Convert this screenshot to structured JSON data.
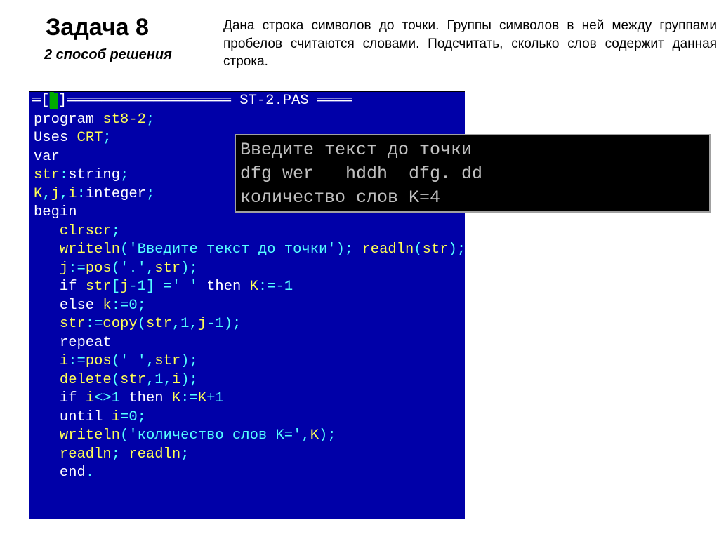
{
  "header": {
    "title": "Задача 8",
    "subtitle": "2 способ решения",
    "description": "Дана строка символов до точки. Группы символов в ней между группами пробелов считаются словами. Подсчитать, сколько слов содержит данная строка."
  },
  "editor": {
    "title_left": "═[",
    "title_cursor": "▌",
    "title_mid": "]═══════════════════ ",
    "filename": "ST-2.PAS",
    "title_right": " ════",
    "lines": [
      {
        "t": "kw",
        "s": "program "
      },
      {
        "t": "id",
        "s": "st8-2"
      },
      {
        "t": "op",
        "s": ";"
      },
      {
        "t": "br"
      },
      {
        "t": "kw",
        "s": "Uses "
      },
      {
        "t": "id",
        "s": "CRT"
      },
      {
        "t": "op",
        "s": ";"
      },
      {
        "t": "br"
      },
      {
        "t": "kw",
        "s": "var"
      },
      {
        "t": "br"
      },
      {
        "t": "id",
        "s": "str"
      },
      {
        "t": "op",
        "s": ":"
      },
      {
        "t": "kw",
        "s": "string"
      },
      {
        "t": "op",
        "s": ";"
      },
      {
        "t": "br"
      },
      {
        "t": "id",
        "s": "K"
      },
      {
        "t": "op",
        "s": ","
      },
      {
        "t": "id",
        "s": "j"
      },
      {
        "t": "op",
        "s": ","
      },
      {
        "t": "id",
        "s": "i"
      },
      {
        "t": "op",
        "s": ":"
      },
      {
        "t": "kw",
        "s": "integer"
      },
      {
        "t": "op",
        "s": ";"
      },
      {
        "t": "br"
      },
      {
        "t": "kw",
        "s": "begin"
      },
      {
        "t": "br"
      },
      {
        "t": "id",
        "s": "   clrscr"
      },
      {
        "t": "op",
        "s": ";"
      },
      {
        "t": "br"
      },
      {
        "t": "id",
        "s": "   writeln"
      },
      {
        "t": "op",
        "s": "("
      },
      {
        "t": "str",
        "s": "'Введите текст до точки'"
      },
      {
        "t": "op",
        "s": "); "
      },
      {
        "t": "id",
        "s": "readln"
      },
      {
        "t": "op",
        "s": "("
      },
      {
        "t": "id",
        "s": "str"
      },
      {
        "t": "op",
        "s": ");"
      },
      {
        "t": "br"
      },
      {
        "t": "id",
        "s": "   j"
      },
      {
        "t": "op",
        "s": ":="
      },
      {
        "t": "id",
        "s": "pos"
      },
      {
        "t": "op",
        "s": "("
      },
      {
        "t": "str",
        "s": "'.'"
      },
      {
        "t": "op",
        "s": ","
      },
      {
        "t": "id",
        "s": "str"
      },
      {
        "t": "op",
        "s": ");"
      },
      {
        "t": "br"
      },
      {
        "t": "kw",
        "s": "   if "
      },
      {
        "t": "id",
        "s": "str"
      },
      {
        "t": "op",
        "s": "["
      },
      {
        "t": "id",
        "s": "j"
      },
      {
        "t": "op",
        "s": "-"
      },
      {
        "t": "ty",
        "s": "1"
      },
      {
        "t": "op",
        "s": "] ="
      },
      {
        "t": "str",
        "s": "' '"
      },
      {
        "t": "kw",
        "s": " then "
      },
      {
        "t": "id",
        "s": "K"
      },
      {
        "t": "op",
        "s": ":=-"
      },
      {
        "t": "ty",
        "s": "1"
      },
      {
        "t": "br"
      },
      {
        "t": "kw",
        "s": "   else "
      },
      {
        "t": "id",
        "s": "k"
      },
      {
        "t": "op",
        "s": ":="
      },
      {
        "t": "ty",
        "s": "0"
      },
      {
        "t": "op",
        "s": ";"
      },
      {
        "t": "br"
      },
      {
        "t": "id",
        "s": "   str"
      },
      {
        "t": "op",
        "s": ":="
      },
      {
        "t": "id",
        "s": "copy"
      },
      {
        "t": "op",
        "s": "("
      },
      {
        "t": "id",
        "s": "str"
      },
      {
        "t": "op",
        "s": ","
      },
      {
        "t": "ty",
        "s": "1"
      },
      {
        "t": "op",
        "s": ","
      },
      {
        "t": "id",
        "s": "j"
      },
      {
        "t": "op",
        "s": "-"
      },
      {
        "t": "ty",
        "s": "1"
      },
      {
        "t": "op",
        "s": ");"
      },
      {
        "t": "br"
      },
      {
        "t": "kw",
        "s": "   repeat"
      },
      {
        "t": "br"
      },
      {
        "t": "id",
        "s": "   i"
      },
      {
        "t": "op",
        "s": ":="
      },
      {
        "t": "id",
        "s": "pos"
      },
      {
        "t": "op",
        "s": "("
      },
      {
        "t": "str",
        "s": "' '"
      },
      {
        "t": "op",
        "s": ","
      },
      {
        "t": "id",
        "s": "str"
      },
      {
        "t": "op",
        "s": ");"
      },
      {
        "t": "br"
      },
      {
        "t": "id",
        "s": "   delete"
      },
      {
        "t": "op",
        "s": "("
      },
      {
        "t": "id",
        "s": "str"
      },
      {
        "t": "op",
        "s": ","
      },
      {
        "t": "ty",
        "s": "1"
      },
      {
        "t": "op",
        "s": ","
      },
      {
        "t": "id",
        "s": "i"
      },
      {
        "t": "op",
        "s": ");"
      },
      {
        "t": "br"
      },
      {
        "t": "kw",
        "s": "   if "
      },
      {
        "t": "id",
        "s": "i"
      },
      {
        "t": "op",
        "s": "<>"
      },
      {
        "t": "ty",
        "s": "1"
      },
      {
        "t": "kw",
        "s": " then "
      },
      {
        "t": "id",
        "s": "K"
      },
      {
        "t": "op",
        "s": ":="
      },
      {
        "t": "id",
        "s": "K"
      },
      {
        "t": "op",
        "s": "+"
      },
      {
        "t": "ty",
        "s": "1"
      },
      {
        "t": "br"
      },
      {
        "t": "kw",
        "s": "   until "
      },
      {
        "t": "id",
        "s": "i"
      },
      {
        "t": "op",
        "s": "="
      },
      {
        "t": "ty",
        "s": "0"
      },
      {
        "t": "op",
        "s": ";"
      },
      {
        "t": "br"
      },
      {
        "t": "id",
        "s": "   writeln"
      },
      {
        "t": "op",
        "s": "("
      },
      {
        "t": "str",
        "s": "'количество слов K='"
      },
      {
        "t": "op",
        "s": ","
      },
      {
        "t": "id",
        "s": "K"
      },
      {
        "t": "op",
        "s": ");"
      },
      {
        "t": "br"
      },
      {
        "t": "id",
        "s": "   readln"
      },
      {
        "t": "op",
        "s": "; "
      },
      {
        "t": "id",
        "s": "readln"
      },
      {
        "t": "op",
        "s": ";"
      },
      {
        "t": "br"
      },
      {
        "t": "kw",
        "s": "   end"
      },
      {
        "t": "op",
        "s": "."
      }
    ]
  },
  "output": {
    "line1": "Введите текст до точки",
    "line2": "dfg wer   hddh  dfg. dd",
    "line3": "количество слов K=4"
  }
}
